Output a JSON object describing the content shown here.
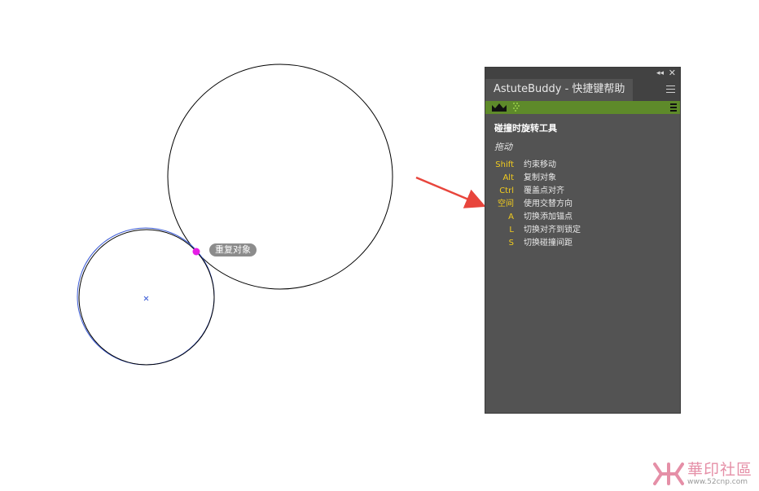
{
  "canvas": {
    "tooltip_label": "重复对象",
    "colors": {
      "stroke": "#000000",
      "guide": "#3b5bd6",
      "anchor": "#e61ee6",
      "arrow": "#e8453c"
    }
  },
  "panel": {
    "collapse_glyph": "◂◂",
    "close_glyph": "✕",
    "tab_title": "AstuteBuddy - 快捷键帮助",
    "tool_title": "碰撞时旋转工具",
    "action_label": "拖动",
    "shortcuts": [
      {
        "key": "Shift",
        "desc": "约束移动"
      },
      {
        "key": "Alt",
        "desc": "复制对象"
      },
      {
        "key": "Ctrl",
        "desc": "覆盖点对齐"
      },
      {
        "key": "空间",
        "desc": "使用交替方向"
      },
      {
        "key": "A",
        "desc": "切换添加锚点"
      },
      {
        "key": "L",
        "desc": "切换对齐到锁定"
      },
      {
        "key": "S",
        "desc": "切换碰撞间距"
      }
    ],
    "colors": {
      "background": "#535353",
      "header": "#424242",
      "accent": "#5e8a2a",
      "key": "#f2cc1e"
    },
    "icons": [
      "collapse-icon",
      "close-icon",
      "panel-menu-icon",
      "crown-icon",
      "dots-icon",
      "bar-menu-icon"
    ]
  },
  "watermark": {
    "title": "華印社區",
    "url": "www.52cnp.com"
  }
}
